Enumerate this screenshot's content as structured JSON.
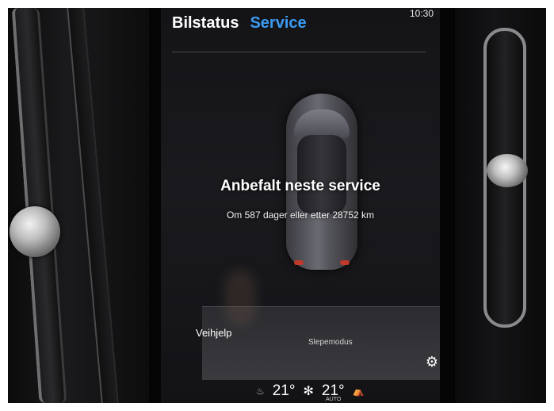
{
  "status_bar": {
    "time": "10:30"
  },
  "tabs": [
    {
      "label": "Bilstatus",
      "active": true
    },
    {
      "label": "Service",
      "active": false
    }
  ],
  "service": {
    "headline": "Anbefalt neste service",
    "details": "Om 587 dager eller etter 28752 km"
  },
  "bottom": {
    "veihjelp_label": "Veihjelp",
    "slepemodus_label": "Slepemodus"
  },
  "climate": {
    "left_temp": "21°",
    "right_temp": "21°",
    "fan_mode": "AUTO"
  },
  "colors": {
    "accent": "#3a9bf3",
    "background": "#141417",
    "text": "#ffffff"
  },
  "icons": [
    "settings-gear-icon",
    "seat-heat-icon",
    "fan-icon",
    "seat-icon"
  ]
}
